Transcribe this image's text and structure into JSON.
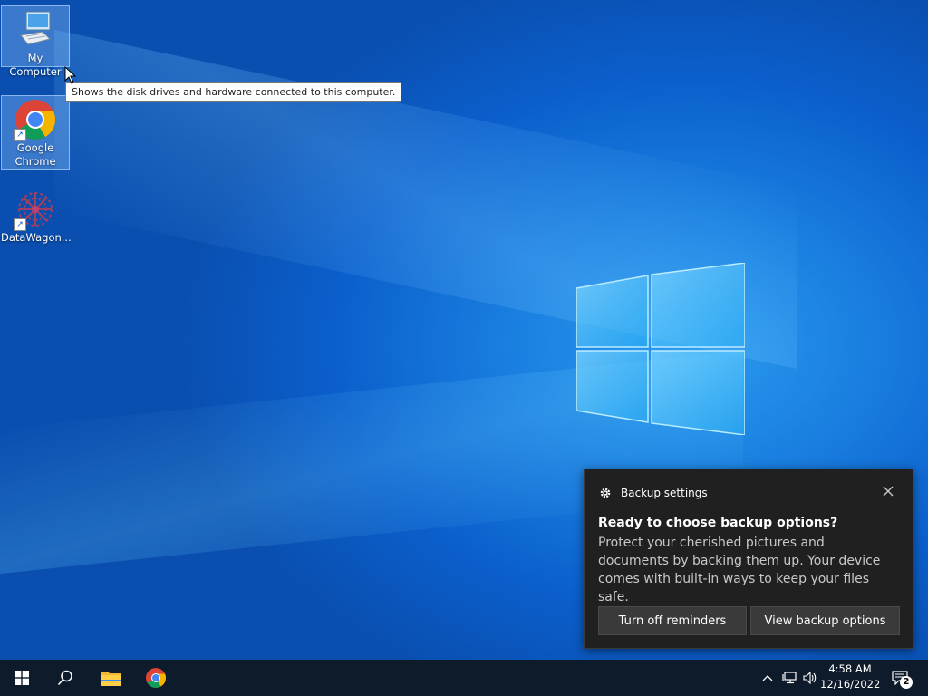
{
  "desktop": {
    "icons": [
      {
        "label": "My Computer",
        "icon": "computer-icon"
      },
      {
        "label": "Google\nChrome",
        "icon": "chrome-icon"
      },
      {
        "label": "DataWagon...",
        "icon": "datawagon-icon"
      }
    ],
    "tooltip": "Shows the disk drives and hardware connected to this computer."
  },
  "toast": {
    "app": "Backup settings",
    "title": "Ready to choose backup options?",
    "body": "Protect your cherished pictures and documents by backing them up. Your device comes with built-in ways to keep your files safe.",
    "buttons": {
      "off": "Turn off reminders",
      "view": "View backup options"
    }
  },
  "taskbar": {
    "pinned": [
      "start-icon",
      "search-icon",
      "file-explorer-icon",
      "chrome-icon"
    ],
    "tray_icons": [
      "chevron-up-icon",
      "network-icon",
      "volume-icon"
    ],
    "time": "4:58 AM",
    "date": "12/16/2022",
    "notification_count": "2"
  },
  "colors": {
    "wallpaper": "#0b5fcc",
    "taskbar": "#0d1b2a",
    "toast_bg": "#202020"
  }
}
